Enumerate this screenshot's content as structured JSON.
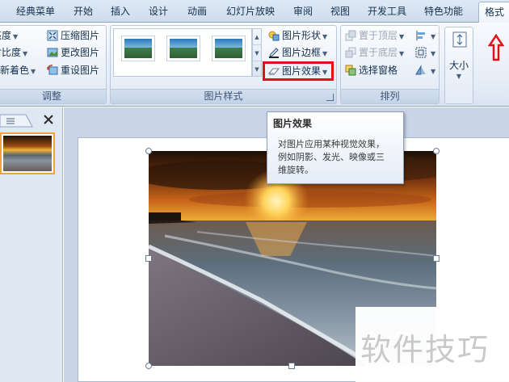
{
  "tabs": [
    {
      "label": "经典菜单"
    },
    {
      "label": "开始"
    },
    {
      "label": "插入"
    },
    {
      "label": "设计"
    },
    {
      "label": "动画"
    },
    {
      "label": "幻灯片放映"
    },
    {
      "label": "审阅"
    },
    {
      "label": "视图"
    },
    {
      "label": "开发工具"
    },
    {
      "label": "特色功能"
    },
    {
      "label": "格式"
    }
  ],
  "adjust_group": {
    "label": "调整",
    "brightness": "亮度",
    "contrast": "对比度",
    "recolor": "重新着色",
    "compress": "压缩图片",
    "change": "更改图片",
    "reset": "重设图片"
  },
  "styles_group": {
    "label": "图片样式",
    "shape": "图片形状",
    "border": "图片边框",
    "effects": "图片效果"
  },
  "arrange_group": {
    "label": "排列",
    "bring_front": "置于顶层",
    "send_back": "置于底层",
    "selection_pane": "选择窗格"
  },
  "size_group": {
    "label": "大小"
  },
  "tooltip": {
    "title": "图片效果",
    "line1": "对图片应用某种视觉效果，",
    "line2": "例如阴影、发光、映像或三",
    "line3": "维旋转。"
  },
  "watermark": "软件技巧",
  "colors": {
    "highlight": "#e0101a",
    "accent": "#f0a23c"
  }
}
